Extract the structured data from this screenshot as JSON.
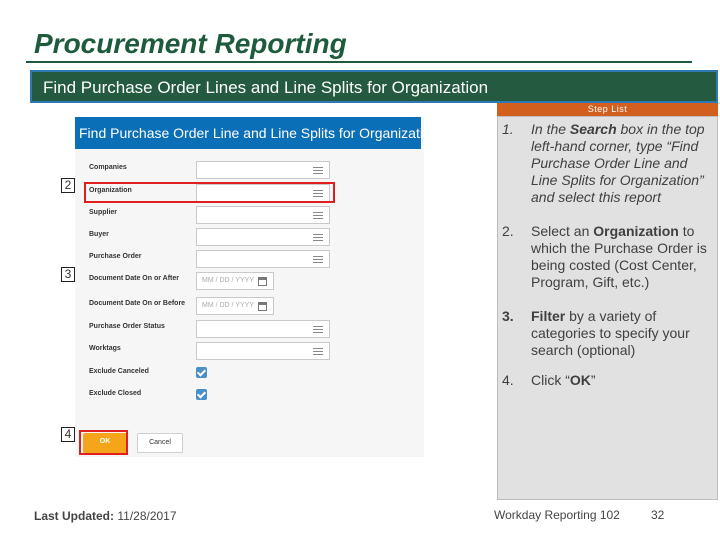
{
  "slide": {
    "title": "Procurement Reporting",
    "banner": "Find Purchase Order Lines and Line Splits for Organization"
  },
  "step_list": {
    "header": "Step List",
    "steps": [
      {
        "num": "1.",
        "pre": "In the ",
        "bold": "Search",
        "post": " box in the top left-hand corner, type “Find Purchase Order Line and Line Splits for Organization” and select this report"
      },
      {
        "num": "2.",
        "pre": "Select an ",
        "bold": "Organization",
        "post": " to which the Purchase Order is being costed (Cost Center, Program, Gift, etc.)"
      },
      {
        "num": "3.",
        "pre": "",
        "bold": "Filter",
        "post": " by a variety of categories to specify your search (optional)"
      },
      {
        "num": "4.",
        "pre": "Click “",
        "bold": "OK",
        "post": "”"
      }
    ]
  },
  "workday_form": {
    "title": "Find Purchase Order Line and Line Splits for Organization",
    "fields": {
      "companies": "Companies",
      "organization": "Organization",
      "supplier": "Supplier",
      "buyer": "Buyer",
      "purchase_order": "Purchase Order",
      "date_after": "Document Date On or After",
      "date_before": "Document Date On or Before",
      "po_status": "Purchase Order Status",
      "worktags": "Worktags",
      "exclude_canceled": "Exclude Canceled",
      "exclude_closed": "Exclude Closed"
    },
    "date_placeholder": "MM / DD / YYYY",
    "exclude_canceled_checked": true,
    "exclude_closed_checked": true,
    "ok_label": "OK",
    "cancel_label": "Cancel"
  },
  "callouts": {
    "org": "2",
    "filters": "3",
    "ok": "4"
  },
  "footer": {
    "updated_label": "Last Updated:",
    "updated_date": "11/28/2017",
    "course": "Workday Reporting 102",
    "page": "32"
  },
  "colors": {
    "title_green": "#1e5a3c",
    "banner_green": "#245a40",
    "step_orange": "#d35f1f",
    "workday_blue": "#0b6fb8",
    "ok_orange": "#f5a51a",
    "highlight_red": "#e02020"
  }
}
